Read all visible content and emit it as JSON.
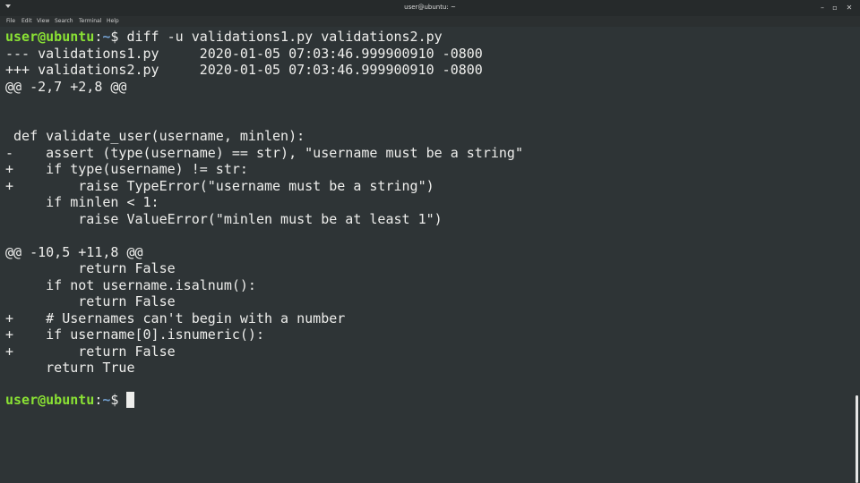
{
  "window": {
    "title": "user@ubuntu: ~",
    "buttons": {
      "minimize": "–",
      "maximize": "▫",
      "close": "✕"
    }
  },
  "menu": [
    "File",
    "Edit",
    "View",
    "Search",
    "Terminal",
    "Help"
  ],
  "prompt": {
    "user": "user@ubuntu",
    "separator": ":",
    "path": "~",
    "symbol": "$ "
  },
  "command": "diff -u validations1.py validations2.py",
  "output": [
    "--- validations1.py     2020-01-05 07:03:46.999900910 -0800",
    "+++ validations2.py     2020-01-05 07:03:46.999900910 -0800",
    "@@ -2,7 +2,8 @@",
    "",
    "",
    " def validate_user(username, minlen):",
    "-    assert (type(username) == str), \"username must be a string\"",
    "+    if type(username) != str:",
    "+        raise TypeError(\"username must be a string\")",
    "     if minlen < 1:",
    "         raise ValueError(\"minlen must be at least 1\")",
    "",
    "@@ -10,5 +11,8 @@",
    "         return False",
    "     if not username.isalnum():",
    "         return False",
    "+    # Usernames can't begin with a number",
    "+    if username[0].isnumeric():",
    "+        return False",
    "     return True"
  ]
}
